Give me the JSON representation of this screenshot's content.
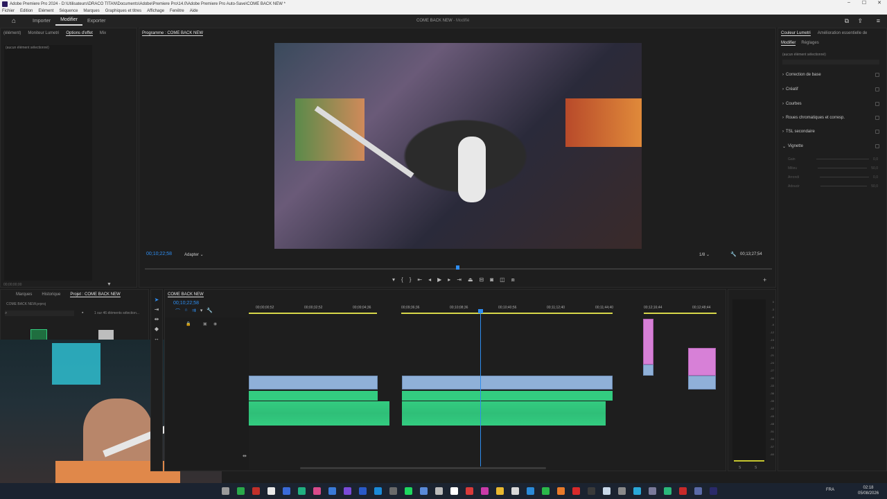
{
  "titlebar": {
    "title": "Adobe Premiere Pro 2024 - D:\\Utilisateurs\\DRACO TITAN\\Documents\\Adobe\\Premiere Pro\\14.0\\Adobe Premiere Pro Auto-Save\\COME BACK NEW *"
  },
  "menu": [
    "Fichier",
    "Edition",
    "Elément",
    "Séquence",
    "Marques",
    "Graphiques et titres",
    "Affichage",
    "Fenêtre",
    "Aide"
  ],
  "header": {
    "workspaces": [
      "Importer",
      "Modifier",
      "Exporter"
    ],
    "active": "Modifier",
    "doc_title": "COME BACK NEW",
    "doc_state": "- Modifié"
  },
  "source_panel": {
    "tabs": [
      "(élément)",
      "Moniteur Lumetri",
      "Options d'effet",
      "Mix"
    ],
    "active_tab": "Options d'effet",
    "empty_text": "(aucun élément sélectionné)",
    "timecode": "00;00;00;00"
  },
  "program_monitor": {
    "tab": "Programme : COME BACK NEW",
    "timecode": "00;10;22;58",
    "fit": "Adapter",
    "resolution": "1/8",
    "duration": "00;13;27;54"
  },
  "lumetri": {
    "tabs": [
      "Couleur Lumetri",
      "Amélioration essentielle de"
    ],
    "subtabs": [
      "Modifier",
      "Réglages"
    ],
    "empty_text": "(aucun élément sélectionné)",
    "sections": [
      "Correction de base",
      "Créatif",
      "Courbes",
      "Roues chromatiques et corresp.",
      "TSL secondaire",
      "Vignette"
    ],
    "vignette_params": [
      {
        "label": "Gain",
        "value": "0,0"
      },
      {
        "label": "Milieu",
        "value": "50,0"
      },
      {
        "label": "Arrondi",
        "value": "0,0"
      },
      {
        "label": "Adoucir",
        "value": "50,0"
      }
    ]
  },
  "project_panel": {
    "tabs": [
      "Marques",
      "Historique",
      "Projet : COME BACK NEW"
    ],
    "active_tab": "Projet : COME BACK NEW",
    "file": "COME BACK NEW.prproj",
    "selection": "1 sur 46 éléments sélection..."
  },
  "timeline": {
    "tab": "COME BACK NEW",
    "timecode": "00;10;22;58",
    "ruler": [
      "00;00;00;52",
      "00;00;32;52",
      "00;09;04;36",
      "00;09;36;36",
      "00;10;08;36",
      "00;10;40;56",
      "00;11;12;40",
      "00;11;44;40",
      "00;12;16;44",
      "00;12;48;44"
    ]
  },
  "audio_meter": {
    "scale": [
      "0",
      "-3",
      "-6",
      "-9",
      "-12",
      "-15",
      "-18",
      "-21",
      "-24",
      "-27",
      "-30",
      "-33",
      "-36",
      "-39",
      "-42",
      "-45",
      "-48",
      "-51",
      "-54",
      "-57",
      "-60",
      "-dB"
    ],
    "channels": [
      "S",
      "S"
    ]
  },
  "taskbar": {
    "lang": "FRA",
    "time": "02:18",
    "date": "05/08/2026"
  },
  "colors": {
    "accent": "#2e8df0",
    "video_clip": "#8fb0d8",
    "audio_clip": "#33cc80",
    "graphic_clip": "#d780d7"
  }
}
